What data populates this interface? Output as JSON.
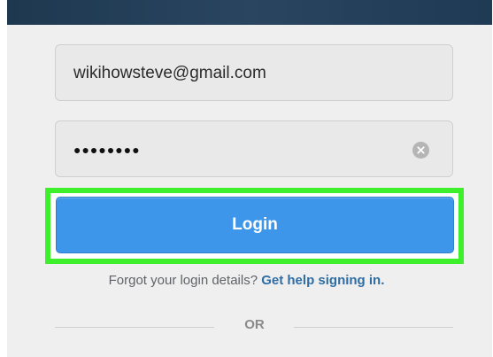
{
  "login_form": {
    "email_value": "wikihowsteve@gmail.com",
    "password_masked": "●●●●●●●●",
    "clear_icon": "clear-x-icon",
    "login_label": "Login",
    "help_text": "Forgot your login details?",
    "help_link": "Get help signing in.",
    "or_divider": "OR"
  },
  "colors": {
    "login_button": "#3d96ea",
    "highlight": "#3ef02c",
    "link": "#2f6da5"
  }
}
